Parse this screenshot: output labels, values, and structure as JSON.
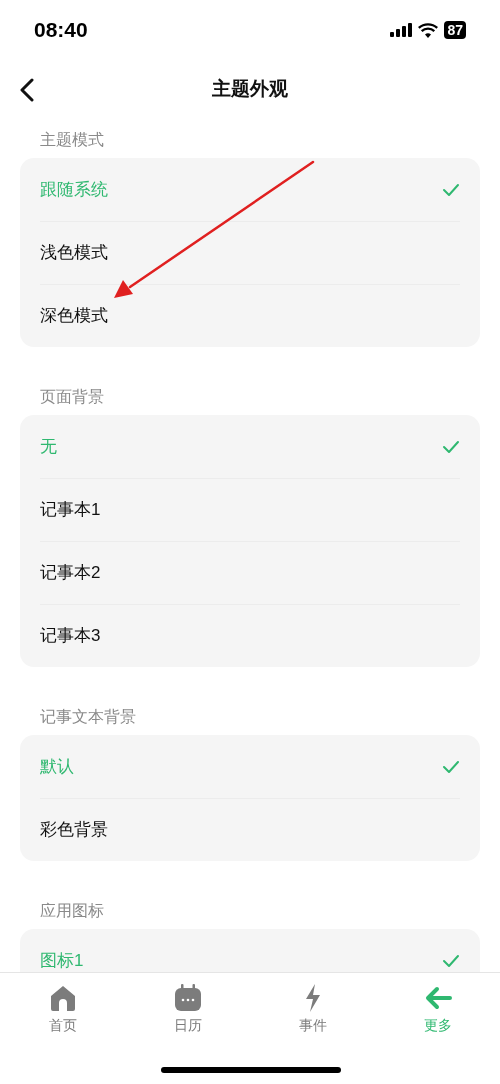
{
  "status_bar": {
    "time": "08:40",
    "battery": "87"
  },
  "header": {
    "title": "主题外观"
  },
  "sections": [
    {
      "label": "主题模式",
      "options": [
        {
          "label": "跟随系统",
          "selected": true
        },
        {
          "label": "浅色模式",
          "selected": false
        },
        {
          "label": "深色模式",
          "selected": false
        }
      ]
    },
    {
      "label": "页面背景",
      "options": [
        {
          "label": "无",
          "selected": true
        },
        {
          "label": "记事本1",
          "selected": false
        },
        {
          "label": "记事本2",
          "selected": false
        },
        {
          "label": "记事本3",
          "selected": false
        }
      ]
    },
    {
      "label": "记事文本背景",
      "options": [
        {
          "label": "默认",
          "selected": true
        },
        {
          "label": "彩色背景",
          "selected": false
        }
      ]
    },
    {
      "label": "应用图标",
      "options": [
        {
          "label": "图标1",
          "selected": true
        }
      ]
    }
  ],
  "tab_bar": [
    {
      "label": "首页",
      "selected": false
    },
    {
      "label": "日历",
      "selected": false
    },
    {
      "label": "事件",
      "selected": false
    },
    {
      "label": "更多",
      "selected": true
    }
  ]
}
